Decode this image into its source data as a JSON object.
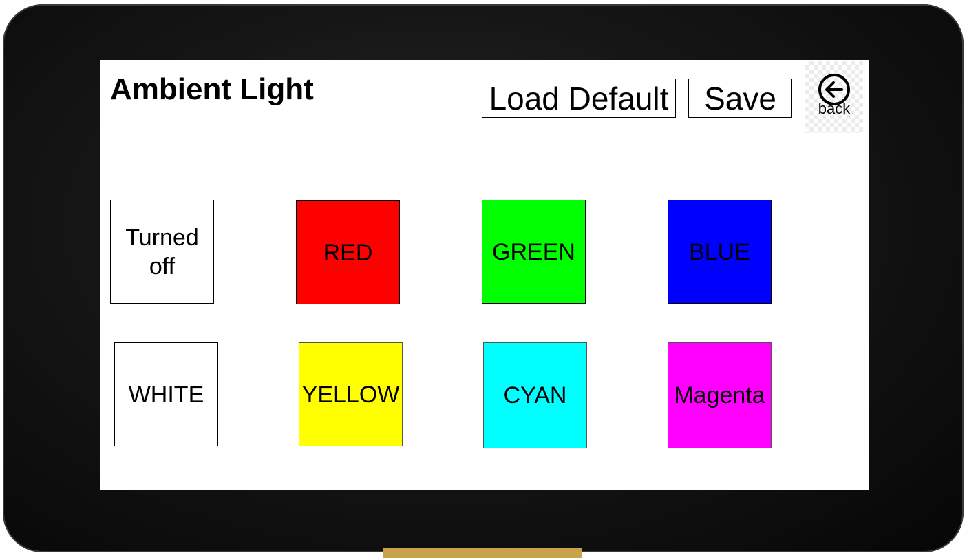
{
  "screen": {
    "title": "Ambient Light",
    "buttons": {
      "load_default": "Load Default",
      "save": "Save",
      "back": "back",
      "back_icon": "arrow-left-circle-icon"
    },
    "colors": {
      "off": {
        "label": "Turned\noff",
        "color": "#ffffff"
      },
      "red": {
        "label": "RED",
        "color": "#ff0000"
      },
      "green": {
        "label": "GREEN",
        "color": "#00ff00"
      },
      "blue": {
        "label": "BLUE",
        "color": "#0000ff"
      },
      "white": {
        "label": "WHITE",
        "color": "#ffffff"
      },
      "yellow": {
        "label": "YELLOW",
        "color": "#ffff00"
      },
      "cyan": {
        "label": "CYAN",
        "color": "#00ffff"
      },
      "magenta": {
        "label": "Magenta",
        "color": "#ff00ff"
      }
    }
  }
}
